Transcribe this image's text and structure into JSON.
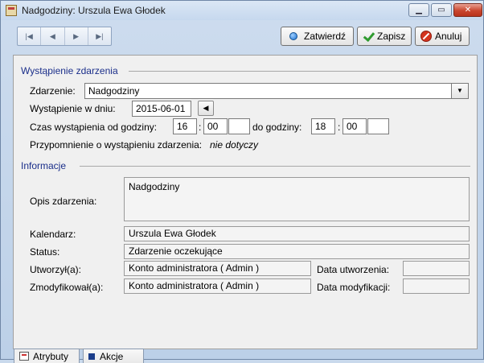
{
  "window": {
    "title": "Nadgodziny: Urszula Ewa Głodek",
    "controls": {
      "minimize": "▁",
      "maximize": "▭",
      "close": "✕"
    }
  },
  "toolbar": {
    "nav": {
      "first": "|◀",
      "prev": "◀",
      "next": "▶",
      "last": "▶|"
    },
    "confirm_label": "Zatwierdź",
    "save_label": "Zapisz",
    "cancel_label": "Anuluj"
  },
  "occurrence": {
    "section_title": "Wystąpienie zdarzenia",
    "event_label": "Zdarzenie:",
    "event_value": "Nadgodziny",
    "day_label": "Wystąpienie w dniu:",
    "day_value": "2015-06-01",
    "time_from_label": "Czas wystąpienia od godziny:",
    "from_hour": "16",
    "from_minute": "00",
    "from_extra": "",
    "colon": ":",
    "time_to_label": "do godziny:",
    "to_hour": "18",
    "to_minute": "00",
    "to_extra": "",
    "reminder_label": "Przypomnienie o wystąpieniu zdarzenia:",
    "reminder_value": "nie dotyczy"
  },
  "info": {
    "section_title": "Informacje",
    "description_label": "Opis zdarzenia:",
    "description_value": "Nadgodziny",
    "calendar_label": "Kalendarz:",
    "calendar_value": "Urszula Ewa Głodek",
    "status_label": "Status:",
    "status_value": "Zdarzenie oczekujące",
    "created_by_label": "Utworzył(a):",
    "created_by_value": "Konto administratora ( Admin )",
    "created_date_label": "Data utworzenia:",
    "created_date_value": "",
    "modified_by_label": "Zmodyfikował(a):",
    "modified_by_value": "Konto administratora ( Admin )",
    "modified_date_label": "Data modyfikacji:",
    "modified_date_value": ""
  },
  "tabs": [
    {
      "label": "Atrybuty"
    },
    {
      "label": "Akcje"
    }
  ]
}
